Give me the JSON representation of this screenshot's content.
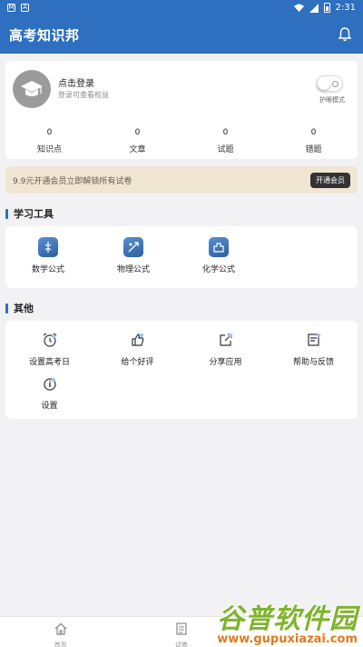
{
  "status_bar": {
    "left_badges": [
      "M",
      "A"
    ],
    "time": "2:31"
  },
  "app": {
    "title": "高考知识邦"
  },
  "profile": {
    "login_title": "点击登录",
    "login_sub": "登录可查看权益",
    "toggle_label": "护眼模式",
    "eye_mode_on": false,
    "stats": [
      {
        "value": "0",
        "label": "知识点"
      },
      {
        "value": "0",
        "label": "文章"
      },
      {
        "value": "0",
        "label": "试题"
      },
      {
        "value": "0",
        "label": "错题"
      }
    ]
  },
  "vip": {
    "text": "9.9元开通会员立即解锁所有试卷",
    "button": "开通会员"
  },
  "tools_section": {
    "title": "学习工具",
    "items": [
      {
        "label": "数学公式",
        "icon": "math-formula-icon"
      },
      {
        "label": "物理公式",
        "icon": "physics-formula-icon"
      },
      {
        "label": "化学公式",
        "icon": "chemistry-formula-icon"
      }
    ]
  },
  "other_section": {
    "title": "其他",
    "items": [
      {
        "label": "设置高考日",
        "icon": "alarm-clock-icon"
      },
      {
        "label": "给个好评",
        "icon": "thumbs-up-icon"
      },
      {
        "label": "分享应用",
        "icon": "share-icon"
      },
      {
        "label": "帮助与反馈",
        "icon": "feedback-icon"
      },
      {
        "label": "设置",
        "icon": "info-icon"
      }
    ]
  },
  "bottom_nav": [
    {
      "label": "首页",
      "icon": "home-icon"
    },
    {
      "label": "试卷",
      "icon": "document-icon"
    }
  ],
  "watermark": {
    "title": "谷普软件园",
    "url": "www.gupuxiazai.com"
  },
  "colors": {
    "primary": "#2e6fbf",
    "vip_bg": "#f1e5d3",
    "background": "#f2f2f4"
  }
}
